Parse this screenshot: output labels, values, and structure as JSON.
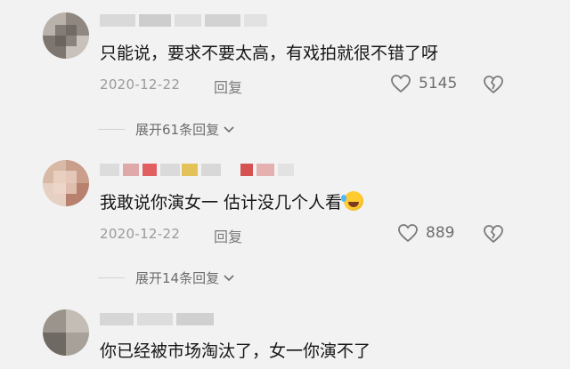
{
  "comments": [
    {
      "text": "只能说，要求不要太高，有戏拍就很不错了呀",
      "date": "2020-12-22",
      "reply_label": "回复",
      "likes": "5145",
      "expand_label": "展开61条回复"
    },
    {
      "text": "我敢说你演女一 估计没几个人看",
      "emoji": "rolling-on-floor-laughing-emoji",
      "date": "2020-12-22",
      "reply_label": "回复",
      "likes": "889",
      "expand_label": "展开14条回复"
    },
    {
      "text": "你已经被市场淘汰了，女一你演不了"
    }
  ],
  "icons": {
    "like": "heart-outline-icon",
    "dislike": "broken-heart-icon",
    "expand": "chevron-down-icon"
  },
  "colors": {
    "background": "#f2f2f2",
    "date": "#9a9a9a",
    "icon": "#7a7a7a"
  }
}
